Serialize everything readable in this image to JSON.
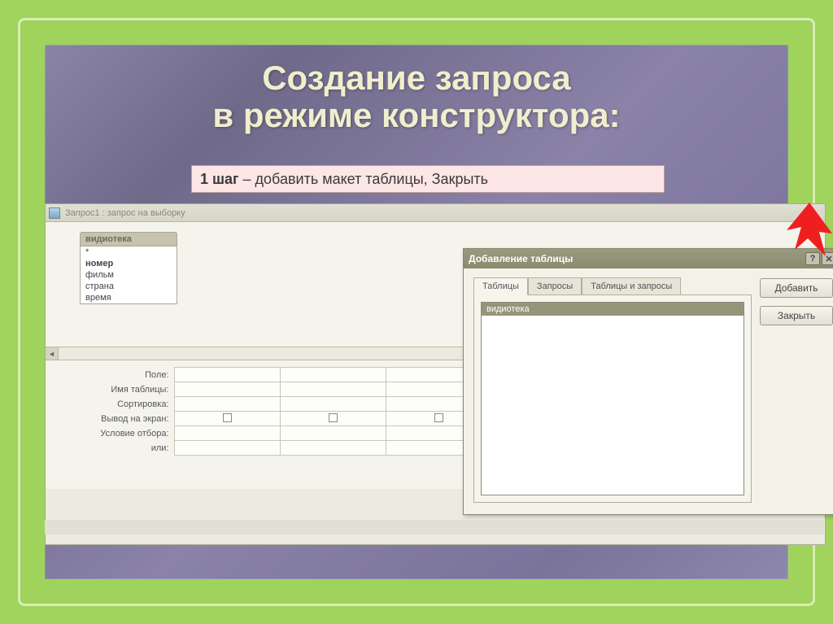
{
  "title_line1": "Создание запроса",
  "title_line2": "в режиме конструктора:",
  "step": {
    "bold": "1 шаг",
    "rest": " – добавить макет таблицы, Закрыть"
  },
  "app_window": {
    "title": "Запрос1 : запрос на выборку",
    "table_widget": {
      "header": "видиотека",
      "items": [
        "*",
        "номер",
        "фильм",
        "страна",
        "время"
      ]
    },
    "grid_labels": [
      "Поле:",
      "Имя таблицы:",
      "Сортировка:",
      "Вывод на экран:",
      "Условие отбора:",
      "или:"
    ]
  },
  "dialog": {
    "title": "Добавление таблицы",
    "tabs": [
      "Таблицы",
      "Запросы",
      "Таблицы и запросы"
    ],
    "active_tab": 0,
    "list_items": [
      "видиотека"
    ],
    "buttons": {
      "add": "Добавить",
      "close": "Закрыть"
    }
  }
}
